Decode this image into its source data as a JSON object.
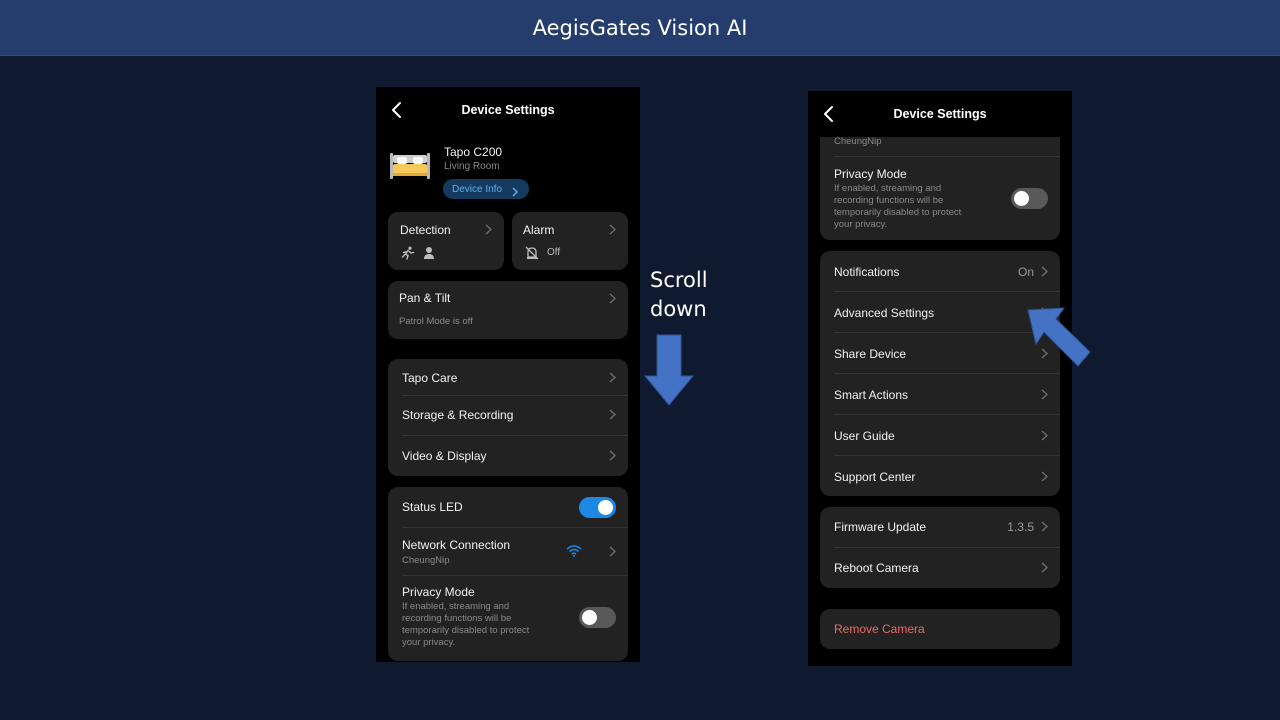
{
  "banner": {
    "title": "AegisGates Vision AI"
  },
  "annotation": {
    "scroll_line1": "Scroll",
    "scroll_line2": "down"
  },
  "colors": {
    "banner_bg": "#243d6d",
    "page_bg": "#0f1a31",
    "accent": "#1e88e5",
    "arrow": "#4472c4",
    "danger": "#e86a6a"
  },
  "left_phone": {
    "nav": {
      "title": "Device Settings",
      "back_icon": "chevron-left-icon"
    },
    "device": {
      "name": "Tapo C200",
      "room": "Living Room",
      "info_button": "Device Info",
      "icon": "bed-icon"
    },
    "detection": {
      "label": "Detection",
      "icons": [
        "running-person-icon",
        "person-icon"
      ]
    },
    "alarm": {
      "label": "Alarm",
      "status": "Off",
      "icon": "alarm-off-icon"
    },
    "pan_tilt": {
      "label": "Pan & Tilt",
      "sub": "Patrol Mode is off"
    },
    "menu": [
      "Tapo Care",
      "Storage & Recording",
      "Video & Display"
    ],
    "status_led": {
      "label": "Status LED",
      "enabled": true
    },
    "network": {
      "label": "Network Connection",
      "ssid": "CheungNip",
      "icon": "wifi-icon"
    },
    "privacy": {
      "label": "Privacy Mode",
      "description": "If enabled, streaming and recording functions will be temporarily disabled to protect your privacy.",
      "desc_lines": [
        "If enabled, streaming and",
        "recording functions will be",
        "temporarily disabled to protect",
        "your privacy."
      ],
      "enabled": false
    }
  },
  "right_phone": {
    "nav": {
      "title": "Device Settings",
      "back_icon": "chevron-left-icon"
    },
    "network_partial": {
      "ssid": "CheungNip"
    },
    "privacy": {
      "label": "Privacy Mode",
      "desc_lines": [
        "If enabled, streaming and",
        "recording functions will be",
        "temporarily disabled to protect",
        "your privacy."
      ],
      "enabled": false
    },
    "menu": [
      {
        "label": "Notifications",
        "value": "On"
      },
      {
        "label": "Advanced Settings",
        "value": ""
      },
      {
        "label": "Share Device",
        "value": ""
      },
      {
        "label": "Smart Actions",
        "value": ""
      },
      {
        "label": "User Guide",
        "value": ""
      },
      {
        "label": "Support Center",
        "value": ""
      }
    ],
    "firmware": {
      "label": "Firmware Update",
      "version": "1.3.5"
    },
    "reboot": {
      "label": "Reboot Camera"
    },
    "remove": {
      "label": "Remove Camera"
    }
  }
}
